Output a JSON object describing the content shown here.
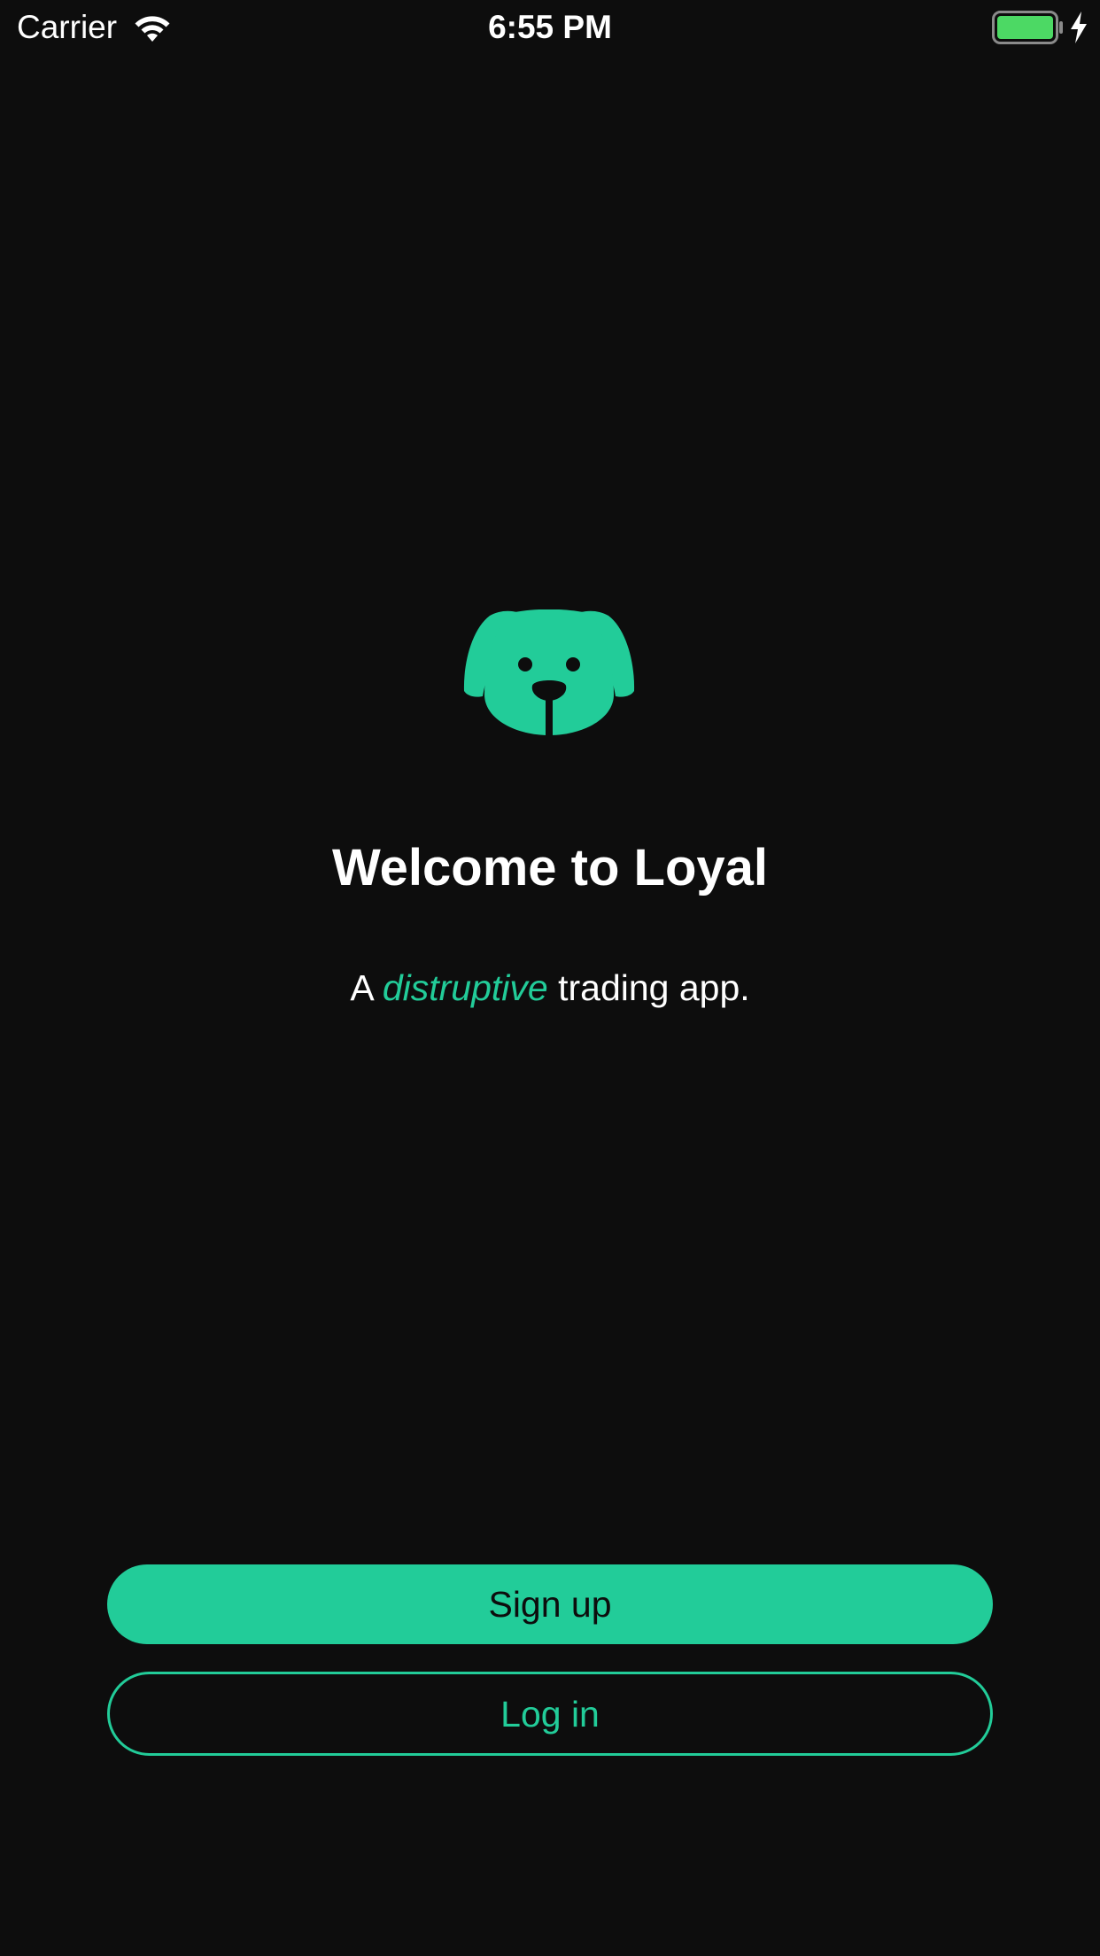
{
  "status_bar": {
    "carrier": "Carrier",
    "time": "6:55 PM",
    "wifi_icon": "wifi-icon",
    "battery_icon": "battery-icon",
    "charging_icon": "charging-bolt-icon",
    "battery_level": 1.0,
    "battery_color": "#4cd964"
  },
  "welcome": {
    "logo_icon": "dog-face-icon",
    "title": "Welcome to Loyal",
    "tagline_prefix": "A ",
    "tagline_emphasis": "distruptive",
    "tagline_suffix": " trading app."
  },
  "actions": {
    "signup_label": "Sign up",
    "login_label": "Log in"
  },
  "colors": {
    "background": "#0d0d0d",
    "accent": "#22cc99",
    "text": "#ffffff"
  }
}
